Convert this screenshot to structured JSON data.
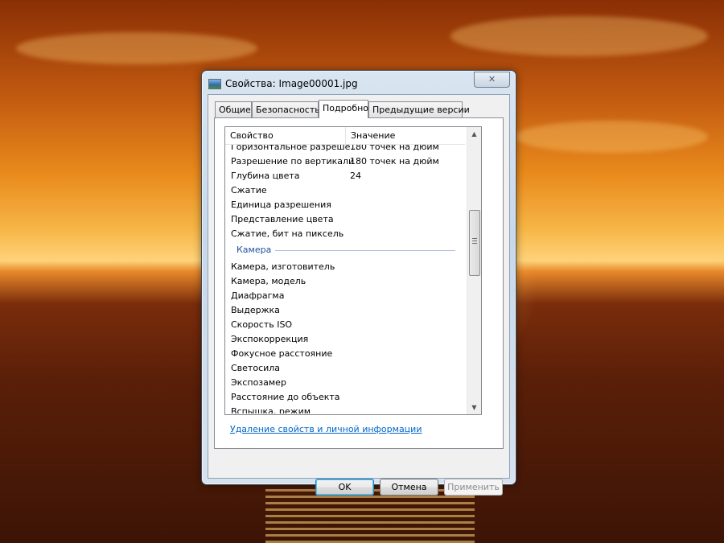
{
  "window": {
    "title": "Свойства: Image00001.jpg",
    "close_label": "✕"
  },
  "tabs": [
    {
      "label": "Общие"
    },
    {
      "label": "Безопасность"
    },
    {
      "label": "Подробно"
    },
    {
      "label": "Предыдущие версии"
    }
  ],
  "active_tab": "Подробно",
  "list": {
    "columns": [
      "Свойство",
      "Значение"
    ],
    "rows": [
      {
        "name": "Горизонтальное разреше...",
        "value": "180 точек на дюйм"
      },
      {
        "name": "Разрешение по вертикали",
        "value": "180 точек на дюйм"
      },
      {
        "name": "Глубина цвета",
        "value": "24"
      },
      {
        "name": "Сжатие",
        "value": ""
      },
      {
        "name": "Единица разрешения",
        "value": ""
      },
      {
        "name": "Представление цвета",
        "value": ""
      },
      {
        "name": "Сжатие, бит на пиксель",
        "value": ""
      }
    ],
    "group": "Камера",
    "camera_rows": [
      {
        "name": "Камера, изготовитель",
        "value": ""
      },
      {
        "name": "Камера, модель",
        "value": ""
      },
      {
        "name": "Диафрагма",
        "value": ""
      },
      {
        "name": "Выдержка",
        "value": ""
      },
      {
        "name": "Скорость ISO",
        "value": ""
      },
      {
        "name": "Экспокоррекция",
        "value": ""
      },
      {
        "name": "Фокусное расстояние",
        "value": ""
      },
      {
        "name": "Светосила",
        "value": ""
      },
      {
        "name": "Экспозамер",
        "value": ""
      },
      {
        "name": "Расстояние до объекта",
        "value": ""
      },
      {
        "name": "Вспышка, режим",
        "value": ""
      }
    ]
  },
  "link_text": "Удаление свойств и личной информации",
  "buttons": {
    "ok": "OK",
    "cancel": "Отмена",
    "apply": "Применить"
  },
  "scroll_arrows": {
    "up": "▲",
    "down": "▼"
  }
}
